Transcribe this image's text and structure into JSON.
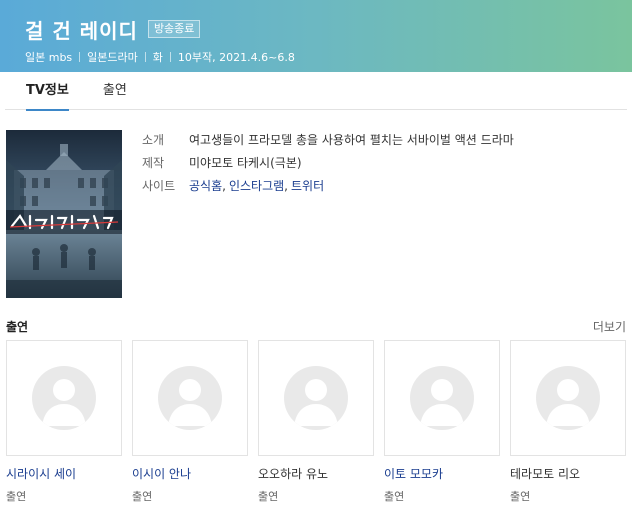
{
  "header": {
    "title": "걸 건 레이디",
    "status": "방송종료",
    "meta": [
      "일본 mbs",
      "일본드라마",
      "화",
      "10부작, 2021.4.6~6.8"
    ]
  },
  "tabs": [
    {
      "label": "TV정보",
      "active": true
    },
    {
      "label": "출연",
      "active": false
    }
  ],
  "info": {
    "intro_label": "소개",
    "intro_value": "여고생들이 프라모델 총을 사용하여 펼치는 서바이벌 액션 드라마",
    "production_label": "제작",
    "production_value": "미야모토 타케시(극본)",
    "site_label": "사이트",
    "sites": [
      "공식홈",
      "인스타그램",
      "트위터"
    ]
  },
  "cast": {
    "title": "출연",
    "more": "더보기",
    "members": [
      {
        "name": "시라이시 세이",
        "role": "출연"
      },
      {
        "name": "이시이 안나",
        "role": "출연"
      },
      {
        "name": "오오하라 유노",
        "role": "출연"
      },
      {
        "name": "이토 모모카",
        "role": "출연"
      },
      {
        "name": "테라모토 리오",
        "role": "출연"
      }
    ]
  },
  "colors": {
    "banner_start": "#5aaad8",
    "banner_end": "#7ac49e",
    "link": "#1a3d8f",
    "tab_underline": "#3d87c8"
  }
}
